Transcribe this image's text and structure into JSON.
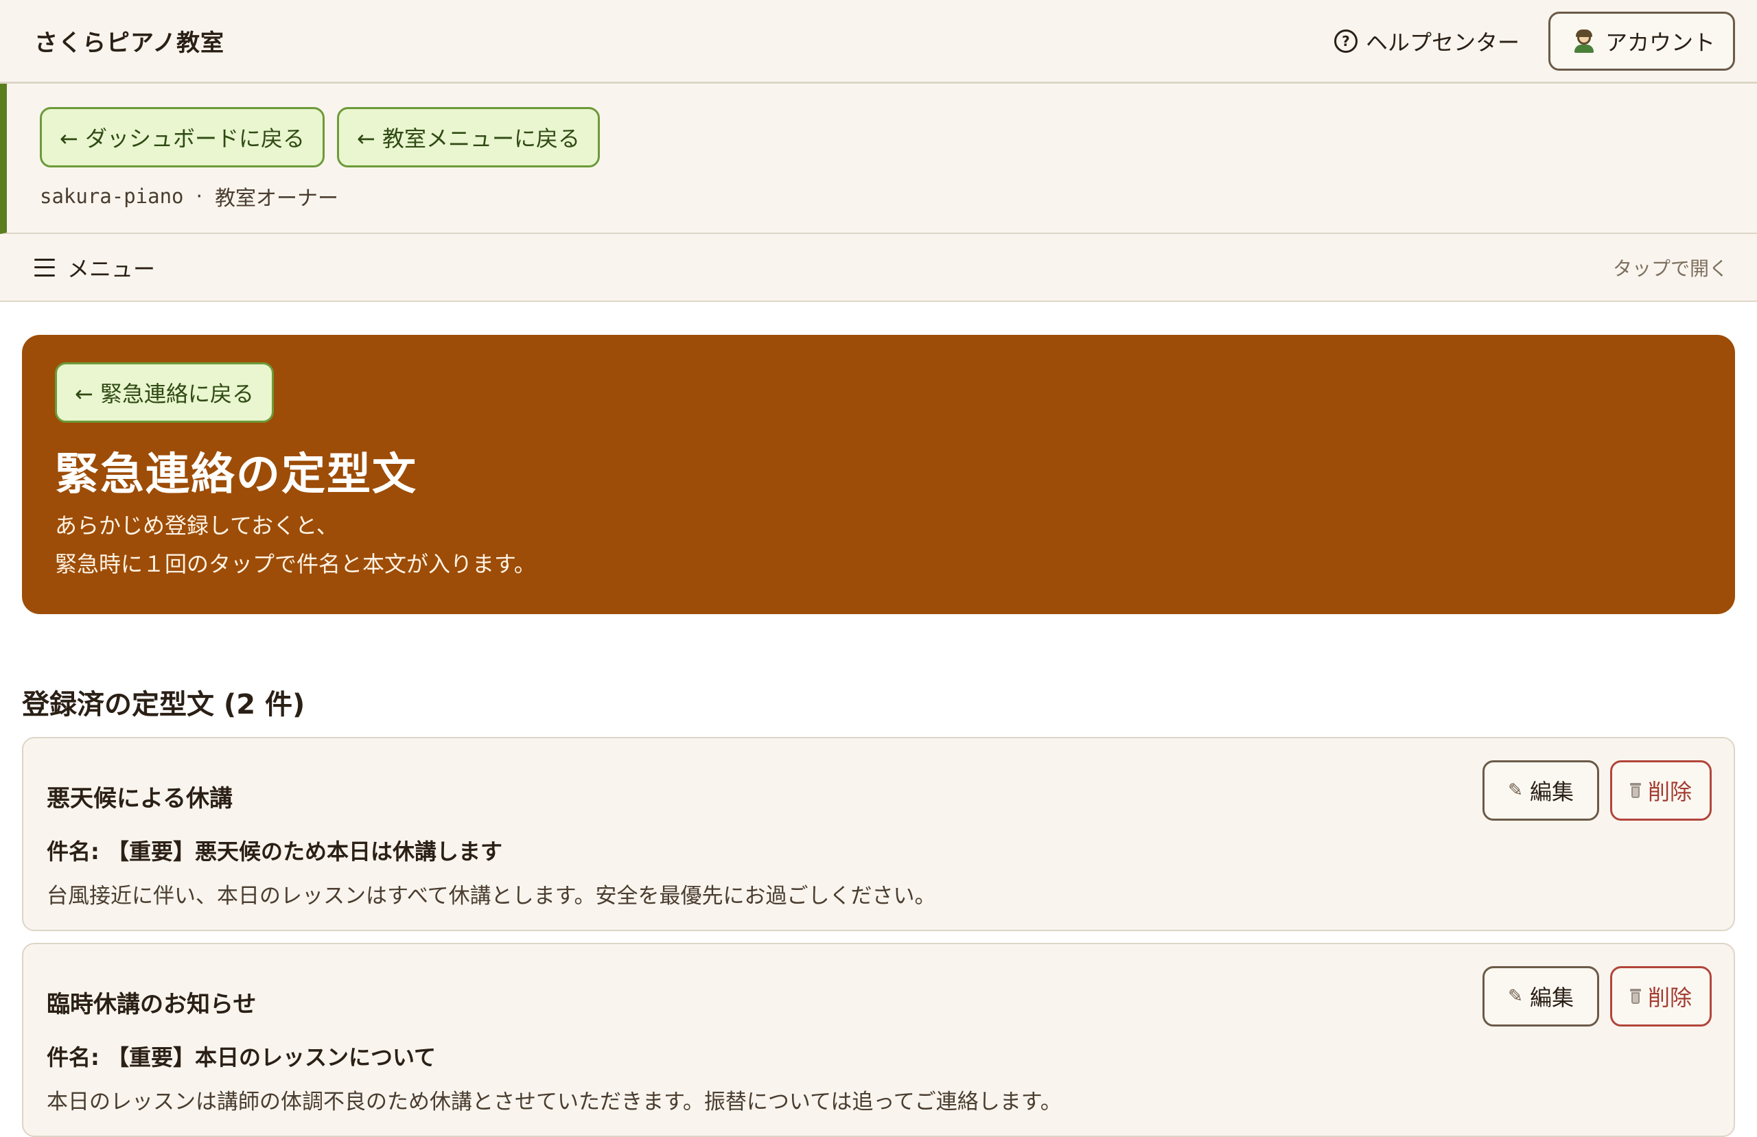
{
  "header": {
    "brand": "さくらピアノ教室",
    "help_label": "ヘルプセンター",
    "account_label": "アカウント"
  },
  "nav": {
    "back_dashboard": "← ダッシュボードに戻る",
    "back_classroom": "← 教室メニューに戻る",
    "org_slug": "sakura-piano",
    "separator": "·",
    "role": "教室オーナー"
  },
  "menu": {
    "label": "メニュー",
    "hint": "タップで開く"
  },
  "hero": {
    "back_label": "← 緊急連絡に戻る",
    "title": "緊急連絡の定型文",
    "desc_line1": "あらかじめ登録しておくと、",
    "desc_line2": "緊急時に１回のタップで件名と本文が入ります。"
  },
  "section": {
    "title": "登録済の定型文 (2 件)"
  },
  "templates": [
    {
      "title": "悪天候による休講",
      "subject": "件名: 【重要】悪天候のため本日は休講します",
      "body": "台風接近に伴い、本日のレッスンはすべて休講とします。安全を最優先にお過ごしください。",
      "edit_label": "編集",
      "delete_label": "削除"
    },
    {
      "title": "臨時休講のお知らせ",
      "subject": "件名: 【重要】本日のレッスンについて",
      "body": "本日のレッスンは講師の体調不良のため休講とさせていただきます。振替については追ってご連絡します。",
      "edit_label": "編集",
      "delete_label": "削除"
    }
  ],
  "colors": {
    "hero_bg": "#9d4d07",
    "accent_green": "#5a7e1e",
    "back_btn_bg": "#e9f6cf",
    "delete_red": "#b2453a",
    "page_bg": "#f9f5ee"
  }
}
